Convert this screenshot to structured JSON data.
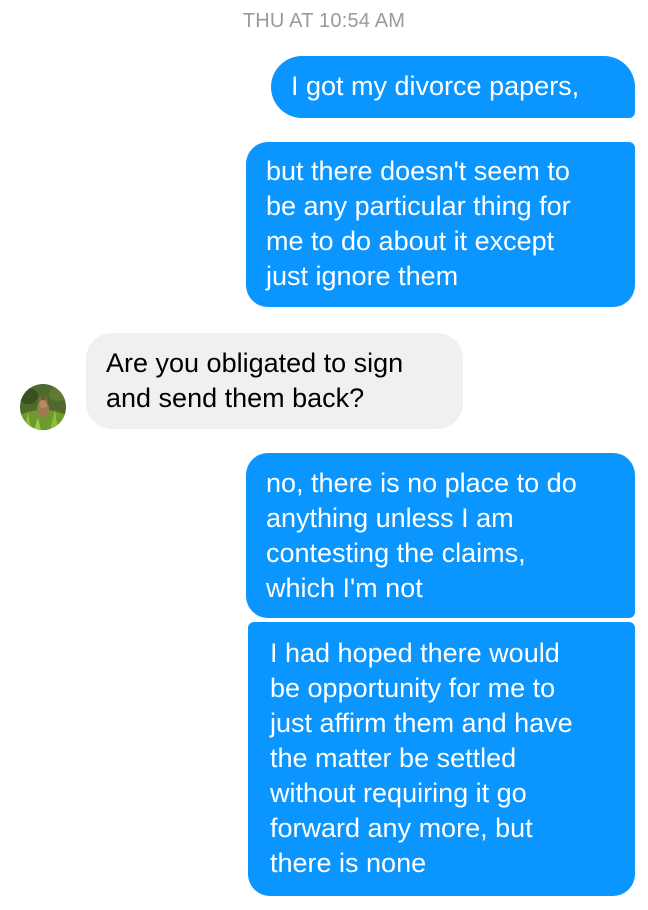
{
  "conversation": {
    "timestamp": "THU AT 10:54 AM",
    "messages": [
      {
        "direction": "out",
        "text": "I got my divorce papers,"
      },
      {
        "direction": "out",
        "text": "but there doesn't seem to\nbe any particular thing for\nme to do about it except\njust ignore them"
      },
      {
        "direction": "in",
        "text": "Are you obligated to sign\nand send them back?"
      },
      {
        "direction": "out",
        "text": "no, there is no place to do\nanything unless I am\ncontesting the claims,\nwhich I'm not"
      },
      {
        "direction": "out",
        "text": "I had hoped there would\nbe opportunity for me to\njust affirm them and have\nthe matter be settled\nwithout requiring it go\nforward any more, but\nthere is none"
      }
    ]
  },
  "colors": {
    "outgoing_bubble": "#0a95ff",
    "incoming_bubble": "#f1f0f0",
    "timestamp_text": "#9a9a9a"
  },
  "icons": {
    "contact_avatar": "avatar-icon"
  }
}
